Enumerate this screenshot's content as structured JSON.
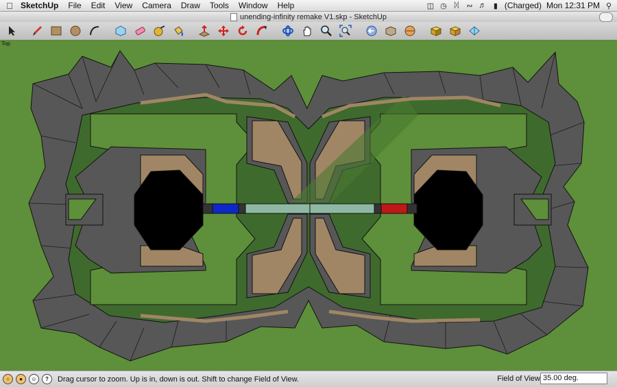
{
  "menubar": {
    "items": [
      "SketchUp",
      "File",
      "Edit",
      "View",
      "Camera",
      "Draw",
      "Tools",
      "Window",
      "Help"
    ],
    "battery": "(Charged)",
    "clock": "Mon 12:31 PM"
  },
  "window": {
    "title": "unending-infinity remake V1.skp - SketchUp"
  },
  "toolbar": {
    "tools": [
      "select-icon",
      "pencil-icon",
      "rectangle-icon",
      "circle-icon",
      "arc-icon",
      "make-component-icon",
      "eraser-icon",
      "tape-measure-icon",
      "paint-bucket-icon",
      "push-pull-icon",
      "move-icon",
      "rotate-icon",
      "follow-me-icon",
      "orbit-icon",
      "pan-icon",
      "zoom-icon",
      "zoom-extents-icon",
      "previous-view-icon",
      "next-view-icon",
      "standard-views-icon",
      "get-models-icon",
      "share-model-icon",
      "3d-warehouse-icon"
    ]
  },
  "viewport": {
    "view_name": "Top",
    "colors": {
      "ground": "#5e8f3a",
      "floor": "#3f6a2d",
      "rock": "#5c5c5c",
      "path": "#a08665",
      "pit": "#000000",
      "blue_team": "#0d28c9",
      "red_team": "#c01818"
    }
  },
  "statusbar": {
    "message": "Drag cursor to zoom.  Up is in, down is out. Shift to change Field of View.",
    "fov_label": "Field of View",
    "fov_value": "35.00 deg."
  }
}
